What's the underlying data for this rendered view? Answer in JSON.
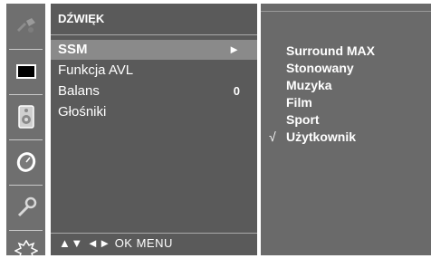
{
  "icon_bar": [
    {
      "name": "setup-icon"
    },
    {
      "name": "picture-icon"
    },
    {
      "name": "audio-icon"
    },
    {
      "name": "time-icon"
    },
    {
      "name": "option-icon"
    },
    {
      "name": "lock-icon"
    }
  ],
  "menu": {
    "title": "DŹWIĘK",
    "items": [
      {
        "label": "SSM",
        "value": "►",
        "selected": true
      },
      {
        "label": "Funkcja AVL",
        "value": ""
      },
      {
        "label": "Balans",
        "value": "0"
      },
      {
        "label": "Głośniki",
        "value": ""
      }
    ],
    "hint": "▲▼ ◄► OK MENU"
  },
  "submenu": {
    "options": [
      {
        "label": "Surround MAX",
        "check": ""
      },
      {
        "label": "Stonowany",
        "check": ""
      },
      {
        "label": "Muzyka",
        "check": ""
      },
      {
        "label": "Film",
        "check": ""
      },
      {
        "label": "Sport",
        "check": ""
      },
      {
        "label": "Użytkownik",
        "check": "√"
      }
    ]
  }
}
